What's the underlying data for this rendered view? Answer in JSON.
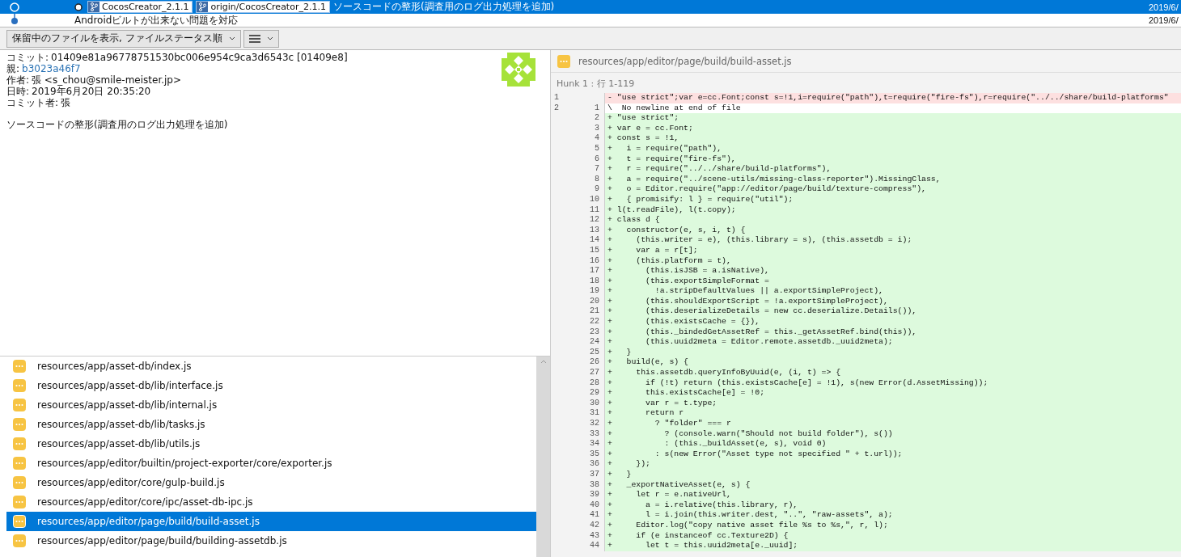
{
  "commits": [
    {
      "selected": true,
      "kind": "hollow",
      "current": true,
      "branches": [
        "CocosCreator_2.1.1",
        "origin/CocosCreator_2.1.1"
      ],
      "message": "ソースコードの整形(調査用のログ出力処理を追加)",
      "date": "2019/6/"
    },
    {
      "selected": false,
      "kind": "filled",
      "current": false,
      "message": "Androidビルトが出来ない問題を対応",
      "date": "2019/6/"
    }
  ],
  "toolbar": {
    "filter": "保留中のファイルを表示, ファイルステータス順"
  },
  "commit_details": {
    "fields": [
      {
        "label": "コミット:",
        "value": "01409e81a96778751530bc006e954c9ca3d6543c [01409e8]",
        "kind": "text"
      },
      {
        "label": "親:",
        "value": "b3023a46f7",
        "kind": "link"
      },
      {
        "label": "作者:",
        "value": "張 <s_chou@smile-meister.jp>",
        "kind": "text"
      },
      {
        "label": "日時:",
        "value": "2019年6月20日 20:35:20",
        "kind": "text"
      },
      {
        "label": "コミット者:",
        "value": "張",
        "kind": "text"
      }
    ],
    "message": "ソースコードの整形(調査用のログ出力処理を追加)"
  },
  "files": [
    {
      "path": "resources/app/asset-db/index.js",
      "selected": false
    },
    {
      "path": "resources/app/asset-db/lib/interface.js",
      "selected": false
    },
    {
      "path": "resources/app/asset-db/lib/internal.js",
      "selected": false
    },
    {
      "path": "resources/app/asset-db/lib/tasks.js",
      "selected": false
    },
    {
      "path": "resources/app/asset-db/lib/utils.js",
      "selected": false
    },
    {
      "path": "resources/app/editor/builtin/project-exporter/core/exporter.js",
      "selected": false
    },
    {
      "path": "resources/app/editor/core/gulp-build.js",
      "selected": false
    },
    {
      "path": "resources/app/editor/core/ipc/asset-db-ipc.js",
      "selected": false
    },
    {
      "path": "resources/app/editor/page/build/build-asset.js",
      "selected": true
    },
    {
      "path": "resources/app/editor/page/build/building-assetdb.js",
      "selected": false
    }
  ],
  "diff": {
    "file": "resources/app/editor/page/build/build-asset.js",
    "hunk": "Hunk 1 : 行 1-119",
    "lines": [
      {
        "kind": "removed",
        "old": "1",
        "text": "- \"use strict\";var e=cc.Font;const s=!1,i=require(\"path\"),t=require(\"fire-fs\"),r=require(\"../../share/build-platforms\""
      },
      {
        "kind": "meta",
        "old": "2",
        "new": "1",
        "text": "\\  No newline at end of file"
      },
      {
        "kind": "added",
        "new": "2",
        "text": "+ \"use strict\";"
      },
      {
        "kind": "added",
        "new": "3",
        "text": "+ var e = cc.Font;"
      },
      {
        "kind": "added",
        "new": "4",
        "text": "+ const s = !1,"
      },
      {
        "kind": "added",
        "new": "5",
        "text": "+   i = require(\"path\"),"
      },
      {
        "kind": "added",
        "new": "6",
        "text": "+   t = require(\"fire-fs\"),"
      },
      {
        "kind": "added",
        "new": "7",
        "text": "+   r = require(\"../../share/build-platforms\"),"
      },
      {
        "kind": "added",
        "new": "8",
        "text": "+   a = require(\"../scene-utils/missing-class-reporter\").MissingClass,"
      },
      {
        "kind": "added",
        "new": "9",
        "text": "+   o = Editor.require(\"app://editor/page/build/texture-compress\"),"
      },
      {
        "kind": "added",
        "new": "10",
        "text": "+   { promisify: l } = require(\"util\");"
      },
      {
        "kind": "added",
        "new": "11",
        "text": "+ l(t.readFile), l(t.copy);"
      },
      {
        "kind": "added",
        "new": "12",
        "text": "+ class d {"
      },
      {
        "kind": "added",
        "new": "13",
        "text": "+   constructor(e, s, i, t) {"
      },
      {
        "kind": "added",
        "new": "14",
        "text": "+     (this.writer = e), (this.library = s), (this.assetdb = i);"
      },
      {
        "kind": "added",
        "new": "15",
        "text": "+     var a = r[t];"
      },
      {
        "kind": "added",
        "new": "16",
        "text": "+     (this.platform = t),"
      },
      {
        "kind": "added",
        "new": "17",
        "text": "+       (this.isJSB = a.isNative),"
      },
      {
        "kind": "added",
        "new": "18",
        "text": "+       (this.exportSimpleFormat ="
      },
      {
        "kind": "added",
        "new": "19",
        "text": "+         !a.stripDefaultValues || a.exportSimpleProject),"
      },
      {
        "kind": "added",
        "new": "20",
        "text": "+       (this.shouldExportScript = !a.exportSimpleProject),"
      },
      {
        "kind": "added",
        "new": "21",
        "text": "+       (this.deserializeDetails = new cc.deserialize.Details()),"
      },
      {
        "kind": "added",
        "new": "22",
        "text": "+       (this.existsCache = {}),"
      },
      {
        "kind": "added",
        "new": "23",
        "text": "+       (this._bindedGetAssetRef = this._getAssetRef.bind(this)),"
      },
      {
        "kind": "added",
        "new": "24",
        "text": "+       (this.uuid2meta = Editor.remote.assetdb._uuid2meta);"
      },
      {
        "kind": "added",
        "new": "25",
        "text": "+   }"
      },
      {
        "kind": "added",
        "new": "26",
        "text": "+   build(e, s) {"
      },
      {
        "kind": "added",
        "new": "27",
        "text": "+     this.assetdb.queryInfoByUuid(e, (i, t) => {"
      },
      {
        "kind": "added",
        "new": "28",
        "text": "+       if (!t) return (this.existsCache[e] = !1), s(new Error(d.AssetMissing));"
      },
      {
        "kind": "added",
        "new": "29",
        "text": "+       this.existsCache[e] = !0;"
      },
      {
        "kind": "added",
        "new": "30",
        "text": "+       var r = t.type;"
      },
      {
        "kind": "added",
        "new": "31",
        "text": "+       return r"
      },
      {
        "kind": "added",
        "new": "32",
        "text": "+         ? \"folder\" === r"
      },
      {
        "kind": "added",
        "new": "33",
        "text": "+           ? (console.warn(\"Should not build folder\"), s())"
      },
      {
        "kind": "added",
        "new": "34",
        "text": "+           : (this._buildAsset(e, s), void 0)"
      },
      {
        "kind": "added",
        "new": "35",
        "text": "+         : s(new Error(\"Asset type not specified \" + t.url));"
      },
      {
        "kind": "added",
        "new": "36",
        "text": "+     });"
      },
      {
        "kind": "added",
        "new": "37",
        "text": "+   }"
      },
      {
        "kind": "added",
        "new": "38",
        "text": "+   _exportNativeAsset(e, s) {"
      },
      {
        "kind": "added",
        "new": "39",
        "text": "+     let r = e.nativeUrl,"
      },
      {
        "kind": "added",
        "new": "40",
        "text": "+       a = i.relative(this.library, r),"
      },
      {
        "kind": "added",
        "new": "41",
        "text": "+       l = i.join(this.writer.dest, \"..\", \"raw-assets\", a);"
      },
      {
        "kind": "added",
        "new": "42",
        "text": "+     Editor.log(\"copy native asset file %s to %s,\", r, l);"
      },
      {
        "kind": "added",
        "new": "43",
        "text": "+     if (e instanceof cc.Texture2D) {"
      },
      {
        "kind": "added",
        "new": "44",
        "text": "+       let t = this.uuid2meta[e._uuid];"
      }
    ]
  }
}
